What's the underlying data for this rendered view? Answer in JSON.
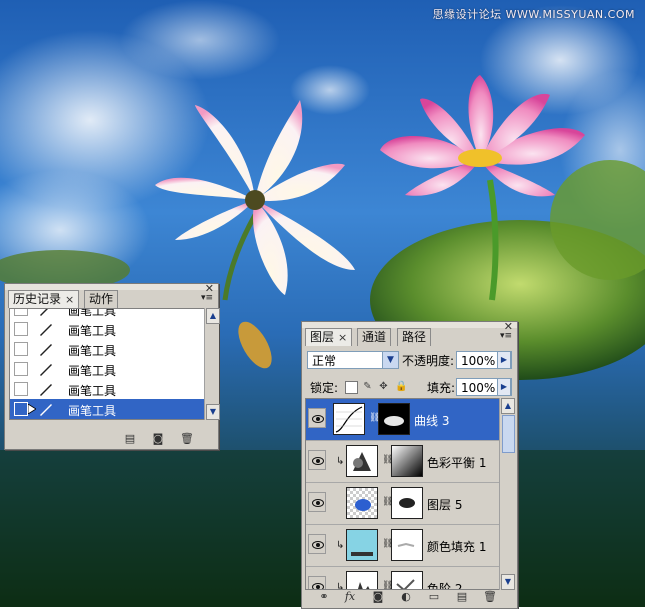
{
  "watermark": "思缘设计论坛 WWW.MISSYUAN.COM",
  "colors": {
    "selection": "#3165c5",
    "panel": "#d4d0c8",
    "sky": "#2a6fc4"
  },
  "history_panel": {
    "tabs": [
      "历史记录",
      "动作"
    ],
    "items": [
      {
        "label": "画笔工具",
        "icon": "brush-icon"
      },
      {
        "label": "画笔工具",
        "icon": "brush-icon"
      },
      {
        "label": "画笔工具",
        "icon": "brush-icon"
      },
      {
        "label": "画笔工具",
        "icon": "brush-icon"
      },
      {
        "label": "画笔工具",
        "icon": "brush-icon"
      },
      {
        "label": "画笔工具",
        "icon": "brush-icon",
        "selected": true
      }
    ],
    "footer_icons": [
      "new-document-from-state-icon",
      "new-snapshot-icon",
      "trash-icon"
    ]
  },
  "layers_panel": {
    "tabs": [
      "图层",
      "通道",
      "路径"
    ],
    "blend_mode": "正常",
    "opacity_label": "不透明度:",
    "opacity_value": "100%",
    "lock_label": "锁定:",
    "fill_label": "填充:",
    "fill_value": "100%",
    "layers": [
      {
        "name": "曲线 3",
        "type": "curves",
        "selected": true,
        "clipped": false
      },
      {
        "name": "色彩平衡 1",
        "type": "color-balance",
        "selected": false,
        "clipped": true
      },
      {
        "name": "图层 5",
        "type": "pixel",
        "selected": false,
        "clipped": false
      },
      {
        "name": "颜色填充 1",
        "type": "color-fill",
        "selected": false,
        "clipped": true
      },
      {
        "name": "色阶 2",
        "type": "levels",
        "selected": false,
        "clipped": true
      }
    ],
    "footer_icons": [
      "link-layers-icon",
      "fx-icon",
      "add-mask-icon",
      "adjustment-layer-icon",
      "new-group-icon",
      "new-layer-icon",
      "trash-icon"
    ]
  }
}
